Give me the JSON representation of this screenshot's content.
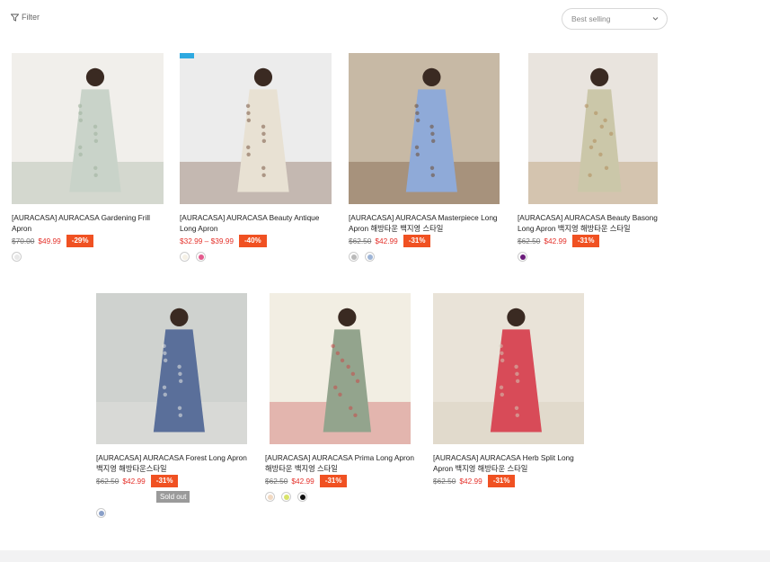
{
  "toolbar": {
    "filter_label": "Filter",
    "sort_value": "Best selling"
  },
  "products": [
    {
      "title": "[AURACASA] AURACASA Gardening Frill Apron",
      "old_price": "$70.00",
      "price": "$49.99",
      "discount": "-29%",
      "swatches": [
        {
          "color": "#e8e8e8",
          "name": "light-gray"
        }
      ],
      "img_colors": [
        "#f1efeb",
        "#c9d3c9",
        "#9db09a"
      ]
    },
    {
      "title": "[AURACASA] AURACASA Beauty Antique Long Apron",
      "price_range": "$32.99 – $39.99",
      "discount": "-40%",
      "badge": true,
      "swatches": [
        {
          "color": "#f6f1e6",
          "name": "ivory"
        },
        {
          "color": "#e45b8d",
          "name": "pink-stripe"
        }
      ],
      "img_colors": [
        "#ececec",
        "#e8e1d3",
        "#7a5a45"
      ]
    },
    {
      "title": "[AURACASA] AURACASA Masterpiece Long Apron 해방타운 백지영 스타일",
      "old_price": "$62.50",
      "price": "$42.99",
      "discount": "-31%",
      "swatches": [
        {
          "color": "#b9b9b9",
          "name": "gray"
        },
        {
          "color": "#9db4d6",
          "name": "light-blue"
        }
      ],
      "img_colors": [
        "#c7b9a5",
        "#8faad8",
        "#6e4a30"
      ]
    },
    {
      "title": "[AURACASA] AURACASA Beauty Basong Long Apron 백지영 해방타운 스타일",
      "old_price": "$62.50",
      "price": "$42.99",
      "discount": "-31%",
      "swatches": [
        {
          "color": "#6a1b7a",
          "name": "purple"
        }
      ],
      "img_colors": [
        "#e9e4de",
        "#cbc7a9",
        "#b08a5a"
      ]
    },
    {
      "title": "[AURACASA] AURACASA Forest Long Apron 백지영 해방타운스타일",
      "old_price": "$62.50",
      "price": "$42.99",
      "discount": "-31%",
      "sold_out": "Sold out",
      "swatches": [
        {
          "color": "#8aa0c8",
          "name": "blue-pattern"
        }
      ],
      "img_colors": [
        "#cfd2cf",
        "#5a6f9a",
        "#e8e8e3"
      ]
    },
    {
      "title": "[AURACASA] AURACASA Prima Long Apron 해방타운 백지영 스타일",
      "old_price": "$62.50",
      "price": "$42.99",
      "discount": "-31%",
      "swatches": [
        {
          "color": "#f1d9c2",
          "name": "beige"
        },
        {
          "color": "#d8e36a",
          "name": "lime"
        },
        {
          "color": "#111111",
          "name": "black"
        }
      ],
      "img_colors": [
        "#f2eee3",
        "#93a48d",
        "#c84a4a"
      ]
    },
    {
      "title": "[AURACASA] AURACASA Herb Split Long Apron 백지영 해방타운 스타일",
      "old_price": "$62.50",
      "price": "$42.99",
      "discount": "-31%",
      "swatches": [],
      "img_colors": [
        "#e9e3d8",
        "#d84b58",
        "#d3c9b6"
      ]
    }
  ]
}
